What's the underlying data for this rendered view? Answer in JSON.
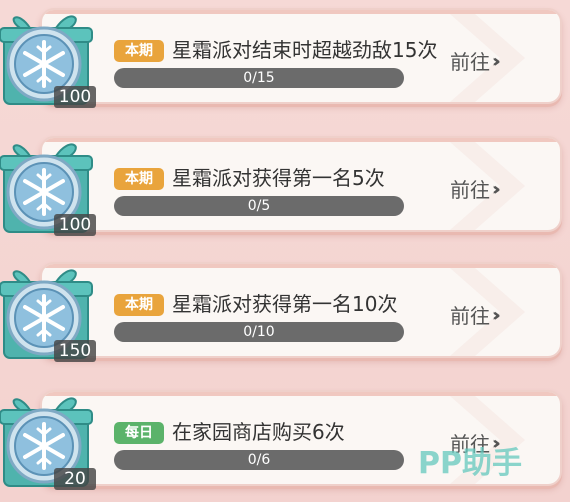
{
  "tasks": [
    {
      "reward": "100",
      "badge": "本期",
      "badge_type": "period",
      "title": "星霜派对结束时超越劲敌15次",
      "progress_text": "0/15",
      "progress": 0,
      "action": "前往"
    },
    {
      "reward": "100",
      "badge": "本期",
      "badge_type": "period",
      "title": "星霜派对获得第一名5次",
      "progress_text": "0/5",
      "progress": 0,
      "action": "前往"
    },
    {
      "reward": "150",
      "badge": "本期",
      "badge_type": "period",
      "title": "星霜派对获得第一名10次",
      "progress_text": "0/10",
      "progress": 0,
      "action": "前往"
    },
    {
      "reward": "20",
      "badge": "每日",
      "badge_type": "daily",
      "title": "在家园商店购买6次",
      "progress_text": "0/6",
      "progress": 0,
      "action": "前往"
    }
  ],
  "watermark": "PP助手",
  "colors": {
    "card_bg": "#fbf7f4",
    "badge_period": "#e9a43c",
    "badge_daily": "#5bb36a",
    "bar": "#6b6b6b",
    "gift": "#4fb3ad"
  },
  "icons": {
    "reward": "snowflake-coin-gift-icon",
    "action": "double-chevron-right-icon"
  }
}
